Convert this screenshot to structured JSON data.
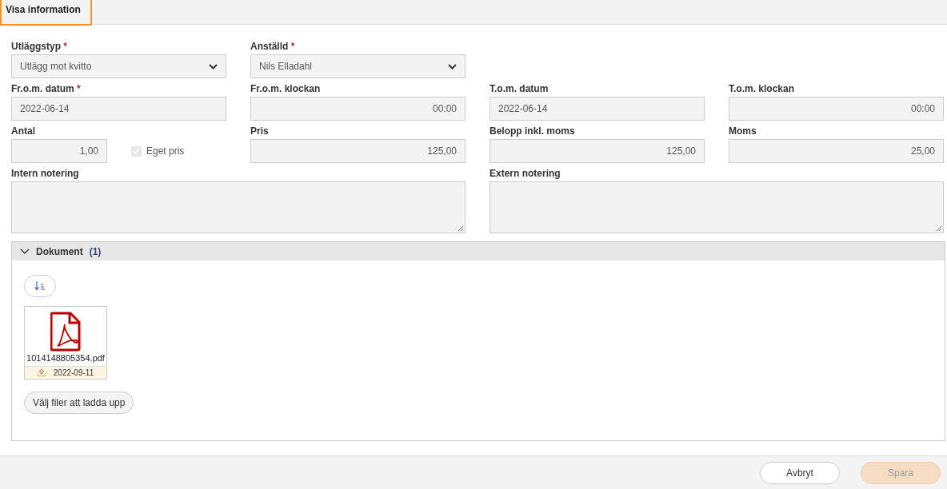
{
  "tab": {
    "title": "Visa information",
    "selected": true
  },
  "form_rows": [
    [
      {
        "kind": "select",
        "label": "Utläggstyp",
        "required_mark": "*",
        "value": "Utlägg mot kvitto"
      },
      {
        "kind": "select",
        "label": "Anställd",
        "required_mark": "*",
        "value": "Nils Elladahl"
      }
    ],
    [
      {
        "kind": "text",
        "label": "Fr.o.m. datum",
        "required_mark": "*",
        "value": "2022-06-14"
      },
      {
        "kind": "number",
        "label": "Fr.o.m. klockan",
        "value": "00:00"
      },
      {
        "kind": "text",
        "label": "T.o.m. datum",
        "value": "2022-06-14"
      },
      {
        "kind": "number",
        "label": "T.o.m. klockan",
        "value": "00:00"
      }
    ],
    [
      {
        "kind": "number",
        "label": "Antal",
        "value": "1,00",
        "checkbox": {
          "label": "Eget pris",
          "checked": true,
          "disabled": true
        }
      },
      {
        "kind": "number",
        "label": "Pris",
        "value": "125,00"
      },
      {
        "kind": "number",
        "label": "Belopp inkl. moms",
        "value": "125,00"
      },
      {
        "kind": "number",
        "label": "Moms",
        "value": "25,00"
      }
    ],
    [
      {
        "kind": "textarea",
        "label": "Intern notering"
      },
      {
        "kind": "textarea",
        "label": "Extern notering"
      }
    ]
  ],
  "documents": {
    "title": "Dokument",
    "count": "(1)",
    "expanded": true,
    "files": [
      {
        "name": "1014148805354.pdf",
        "date": "2022-09-11"
      }
    ],
    "upload_button": "Välj filer att ladda upp"
  },
  "buttons": [
    {
      "label": "Avbryt",
      "kind": "secondary",
      "disabled": false
    },
    {
      "label": "Spara",
      "kind": "primary",
      "disabled": true
    }
  ]
}
